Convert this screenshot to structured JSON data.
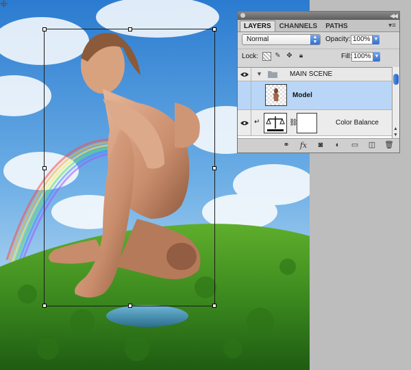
{
  "layers_panel": {
    "tabs": [
      {
        "label": "LAYERS",
        "active": true
      },
      {
        "label": "CHANNELS",
        "active": false
      },
      {
        "label": "PATHS",
        "active": false
      }
    ],
    "blend_mode": "Normal",
    "opacity_label": "Opacity:",
    "opacity_value": "100%",
    "lock_label": "Lock:",
    "fill_label": "Fill:",
    "fill_value": "100%",
    "layers": [
      {
        "name": "MAIN SCENE",
        "type": "group",
        "visible": true,
        "expanded": true
      },
      {
        "name": "Model",
        "type": "pixel",
        "visible": false,
        "selected": true
      },
      {
        "name": "Color Balance",
        "type": "adjustment",
        "visible": true,
        "clipped": true
      }
    ],
    "footer_icons": [
      "link-icon",
      "fx-icon",
      "mask-icon",
      "adjustment-icon",
      "group-folder-icon",
      "new-layer-icon",
      "trash-icon"
    ]
  },
  "canvas": {
    "subject": "woman-sitting-on-hill",
    "colors": {
      "sky_top": "#2f7fcf",
      "grass": "#3f8f22",
      "selection_blue": "#b9d6f7"
    }
  }
}
